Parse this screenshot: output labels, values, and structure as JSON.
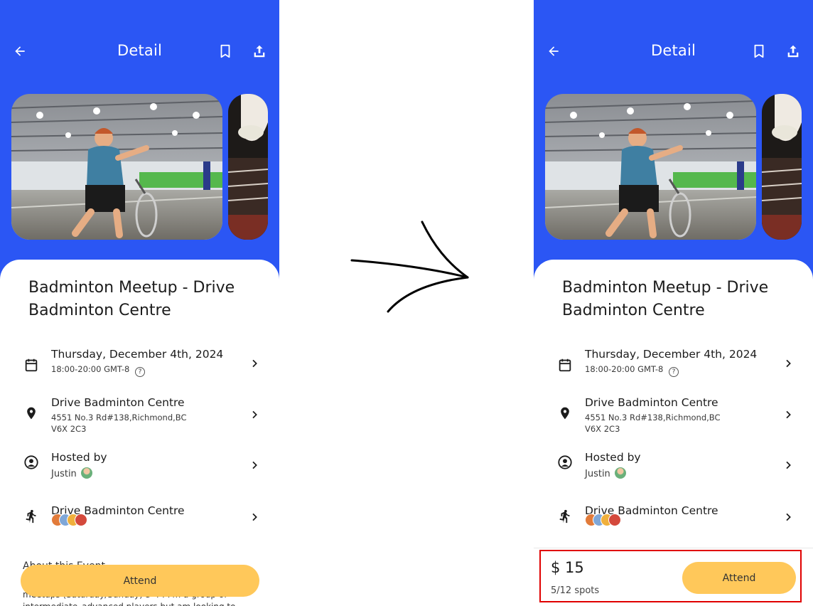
{
  "header": {
    "title": "Detail"
  },
  "event": {
    "title": "Badminton Meetup - Drive Badminton Centre",
    "date": "Thursday, December 4th, 2024",
    "time": "18:00-20:00 GMT-8",
    "venue_name": "Drive Badminton Centre",
    "address": "4551 No.3 Rd#138,Richmond,BC V6X 2C3",
    "hosted_label": "Hosted by",
    "host_name": "Justin",
    "attendees_label": "Drive Badminton Centre"
  },
  "about": {
    "heading": "About this Event",
    "body": "meetups (Saturday/Sunday) 3-4 . I'm a group of intermediate–advanced players but am looking to"
  },
  "actions": {
    "attend_label": "Attend"
  },
  "booking": {
    "price": "$ 15",
    "spots": "5/12 spots"
  },
  "colors": {
    "primary": "#2b56f4",
    "accent": "#ffc85a",
    "highlight": "#e00000"
  }
}
